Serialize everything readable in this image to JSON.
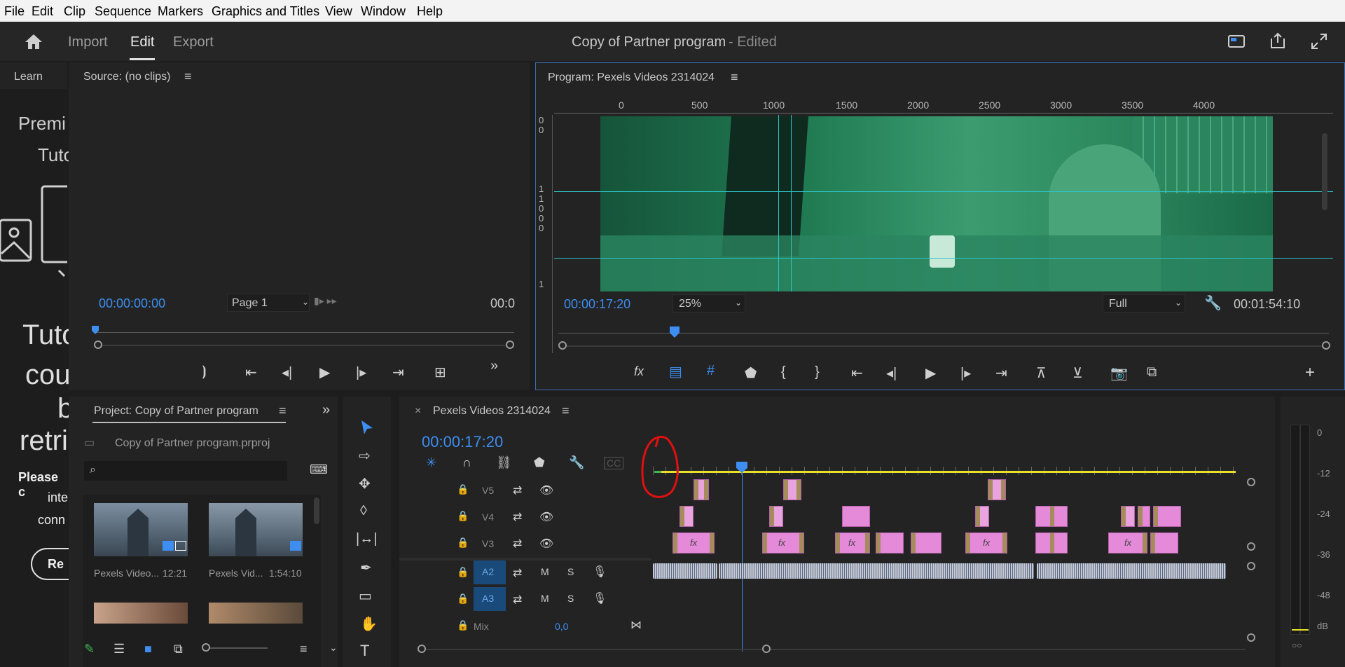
{
  "menu": [
    "File",
    "Edit",
    "Clip",
    "Sequence",
    "Markers",
    "Graphics and Titles",
    "View",
    "Window",
    "Help"
  ],
  "workspace": {
    "tabs": [
      "Import",
      "Edit",
      "Export"
    ],
    "active_tab": "Edit",
    "project_title": "Copy of Partner program",
    "edited_suffix": "- Edited"
  },
  "learn_panel": {
    "tab": "Learn",
    "heading_lines": [
      "Premi",
      "Tuto"
    ],
    "big_text_lines": [
      "Tuto",
      "cou",
      "b",
      "retri"
    ],
    "small_text_lines": [
      "Please c",
      "inte",
      "conn"
    ],
    "button_label": "Re"
  },
  "source_monitor": {
    "title": "Source: (no clips)",
    "timecode": "00:00:00:00",
    "page_select": "Page 1",
    "right_timecode": "00:0"
  },
  "program_monitor": {
    "title": "Program: Pexels Videos 2314024",
    "ruler_labels": [
      "0",
      "500",
      "1000",
      "1500",
      "2000",
      "2500",
      "3000",
      "3500",
      "4000"
    ],
    "vruler_labels": [
      "0",
      "0",
      "1",
      "1",
      "0",
      "0",
      "0",
      "1"
    ],
    "timecode": "00:00:17:20",
    "zoom": "25%",
    "quality": "Full",
    "duration": "00:01:54:10"
  },
  "project_panel": {
    "title": "Project: Copy of Partner program",
    "file": "Copy of Partner program.prproj",
    "search_placeholder": "",
    "items": [
      {
        "name": "Pexels Video...",
        "duration": "12:21"
      },
      {
        "name": "Pexels Vid...",
        "duration": "1:54:10"
      }
    ]
  },
  "timeline": {
    "sequence_name": "Pexels Videos 2314024",
    "timecode": "00:00:17:20",
    "video_tracks": [
      "V5",
      "V4",
      "V3"
    ],
    "audio_tracks": [
      "A2",
      "A3"
    ],
    "mix_label": "Mix",
    "mix_value": "0,0",
    "track_buttons": {
      "mute": "M",
      "solo": "S"
    }
  },
  "audio_meter": {
    "labels": [
      "0",
      "-12",
      "-24",
      "-36",
      "-48",
      "dB"
    ]
  },
  "colors": {
    "accent_blue": "#3d8ef0",
    "clip_pink": "#e48ad8",
    "video_tint": "#1f8a5e",
    "annotation_red": "#e01010",
    "work_area_yellow": "#e8e02a"
  }
}
